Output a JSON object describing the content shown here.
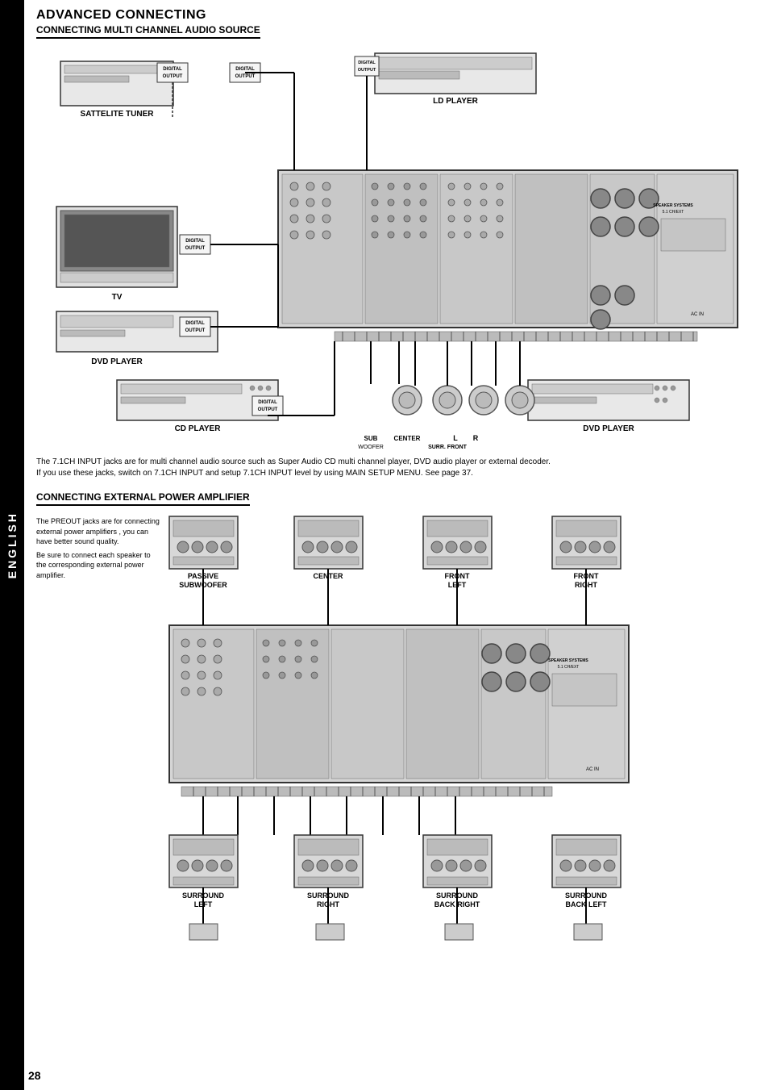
{
  "sidebar": {
    "label": "ENGLISH"
  },
  "page": {
    "number": "28"
  },
  "section1": {
    "title": "ADVANCED CONNECTING",
    "subtitle": "CONNECTING MULTI CHANNEL AUDIO SOURCE",
    "description_line1": "The 7.1CH INPUT jacks are for multi channel audio source such as Super Audio CD multi channel player, DVD audio player or external decoder.",
    "description_line2": "If you use these jacks, switch on 7.1CH INPUT and setup 7.1CH INPUT level by using MAIN SETUP MENU. See page 37.",
    "devices": {
      "satellite_tuner": "SATTELITE TUNER",
      "ld_player": "LD PLAYER",
      "tv": "TV",
      "dvd_player_left": "DVD PLAYER",
      "cd_player": "CD PLAYER",
      "dvd_player_right": "DVD PLAYER",
      "digital_output": "DIGITAL OUTPUT",
      "center_label": "CENTER",
      "l_label": "L",
      "r_label": "R",
      "sub_woofer": "SUB WOOFER",
      "surr_front": "SURR. FRONT"
    }
  },
  "section2": {
    "subtitle": "CONNECTING EXTERNAL POWER AMPLIFIER",
    "description": "The PREOUT jacks are for connecting external power amplifiers , you can have better sound quality.\nBe sure to connect each speaker to the corresponding external power amplifier.",
    "devices": {
      "passive_subwoofer": "PASSIVE\nSUBWOOFER",
      "center": "CENTER",
      "front_left": "FRONT\nLEFT",
      "front_right": "FRONT\nRIGHT",
      "surround_left": "SURROUND\nLEFT",
      "surround_right": "SURROUND\nRIGHT",
      "surround_back_right": "SURROUND\nBACK RIGHT",
      "surround_back_left": "SURROUND\nBACK LEFT"
    }
  }
}
